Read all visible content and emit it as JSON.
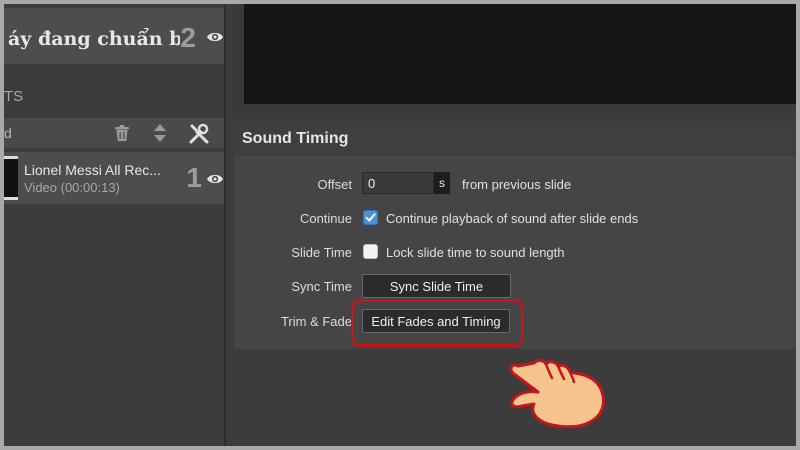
{
  "left_panel": {
    "slide_title": "áy đang chuẩn b",
    "slide_number": "2",
    "section_label": "TS",
    "list_header_text": "d",
    "item": {
      "title": "Lionel Messi  All Rec...",
      "subtitle": "Video (00:00:13)",
      "number": "1"
    }
  },
  "sound_timing": {
    "title": "Sound Timing",
    "offset": {
      "label": "Offset",
      "value": "0",
      "unit": "s",
      "suffix": "from previous slide"
    },
    "continue": {
      "label": "Continue",
      "checked": true,
      "text": "Continue playback of sound after slide ends"
    },
    "slide_time": {
      "label": "Slide Time",
      "checked": false,
      "text": "Lock slide time to sound length"
    },
    "sync_time": {
      "label": "Sync Time",
      "button": "Sync Slide Time"
    },
    "trim_fade": {
      "label": "Trim & Fade",
      "button": "Edit Fades and Timing"
    }
  },
  "icons": {
    "eye": "eye-icon",
    "trash": "trash-icon",
    "sort": "sort-arrows-icon",
    "tools": "tools-icon",
    "check": "checkmark-icon",
    "pointer": "hand-pointer-icon"
  },
  "colors": {
    "highlight": "#c0161c",
    "checkbox_checked": "#4a90d9",
    "panel_bg": "#454545"
  }
}
